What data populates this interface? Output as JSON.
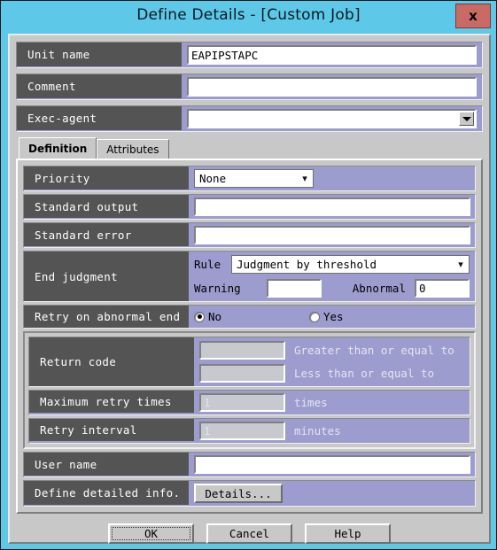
{
  "window": {
    "title": "Define Details - [Custom Job]",
    "close_label": "x",
    "titlebar_color": "#5ec8e8",
    "close_button_color": "#c96a64",
    "panel_color": "#c8c8c8",
    "label_color": "#545454",
    "field_area_color": "#9c9ccf"
  },
  "header_fields": [
    {
      "label": "Unit name",
      "value": "EAPIPSTAPC",
      "kind": "text"
    },
    {
      "label": "Comment",
      "value": "",
      "kind": "text"
    },
    {
      "label": "Exec-agent",
      "value": "",
      "kind": "combo95"
    }
  ],
  "tabs": [
    {
      "label": "Definition",
      "active": true
    },
    {
      "label": "Attributes",
      "active": false
    }
  ],
  "definition": {
    "priority": {
      "label": "Priority",
      "value": "None"
    },
    "standard_output": {
      "label": "Standard output",
      "value": ""
    },
    "standard_error": {
      "label": "Standard error",
      "value": ""
    },
    "end_judgment": {
      "label": "End judgment",
      "rule_label": "Rule",
      "rule_value": "Judgment by threshold",
      "warning_label": "Warning",
      "warning_value": "",
      "abnormal_label": "Abnormal",
      "abnormal_value": "0"
    },
    "retry_on_abnormal_end": {
      "label": "Retry on abnormal end",
      "options": [
        {
          "label": "No",
          "selected": true
        },
        {
          "label": "Yes",
          "selected": false
        }
      ]
    },
    "return_code": {
      "label": "Return code",
      "greater_value": "",
      "greater_label": "Greater than or equal to",
      "less_value": "",
      "less_label": "Less than or equal to"
    },
    "maximum_retry_times": {
      "label": "Maximum retry times",
      "value": "1",
      "unit": "times"
    },
    "retry_interval": {
      "label": "Retry interval",
      "value": "1",
      "unit": "minutes"
    },
    "user_name": {
      "label": "User name",
      "value": ""
    },
    "define_detailed_info": {
      "label": "Define detailed info.",
      "button_label": "Details..."
    }
  },
  "buttons": [
    {
      "label": "OK",
      "default": true
    },
    {
      "label": "Cancel",
      "default": false
    },
    {
      "label": "Help",
      "default": false
    }
  ]
}
